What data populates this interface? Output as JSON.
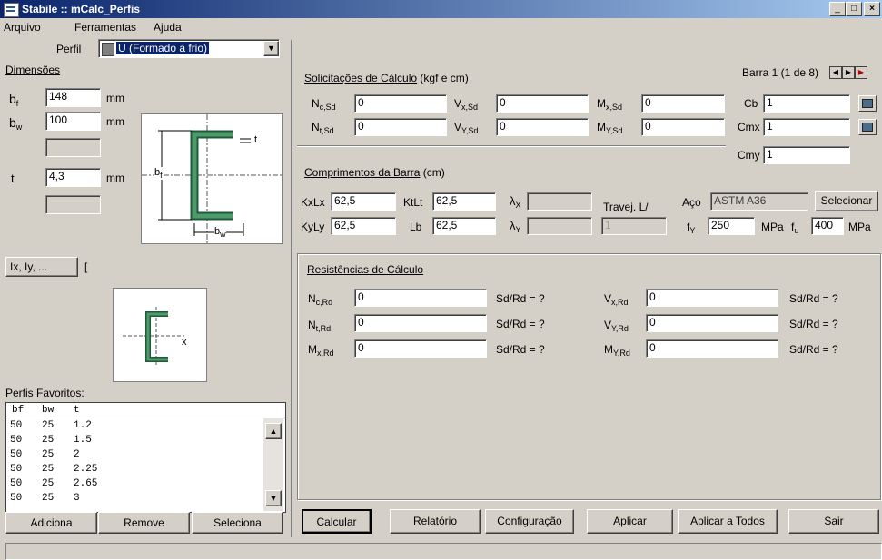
{
  "window": {
    "title": "Stabile :: mCalc_Perfis",
    "minimize": "_",
    "maximize": "□",
    "close": "×"
  },
  "menu": [
    "Arquivo",
    "Ferramentas",
    "Ajuda"
  ],
  "perfil": {
    "label": "Perfil",
    "value": "U (Formado a frio)"
  },
  "dimensoes": {
    "title": "Dimensões",
    "bf_label": "b",
    "bf_sub": "f",
    "bf": "148",
    "bw_label": "b",
    "bw_sub": "w",
    "bw": "100",
    "t_label": "t",
    "t": "4,3",
    "unit": "mm"
  },
  "diagram": {
    "bf": "b",
    "bf_sub": "f",
    "bw": "b",
    "bw_sub": "w",
    "t": "t",
    "x": "x"
  },
  "ixiy": {
    "button": "Ix, Iy, ...",
    "value": "["
  },
  "favoritos": {
    "title": "Perfis Favoritos:",
    "headers": [
      "bf",
      "bw",
      "t"
    ],
    "rows": [
      [
        "50",
        "25",
        "1.2"
      ],
      [
        "50",
        "25",
        "1.5"
      ],
      [
        "50",
        "25",
        "2"
      ],
      [
        "50",
        "25",
        "2.25"
      ],
      [
        "50",
        "25",
        "2.65"
      ],
      [
        "50",
        "25",
        "3"
      ]
    ],
    "buttons": [
      "Adiciona",
      "Remove",
      "Seleciona"
    ]
  },
  "solicitacoes": {
    "title": "Solicitações de Cálculo",
    "units": " (kgf e cm)",
    "barra": "Barra 1 (1 de 8)",
    "fields": [
      {
        "sym": "N",
        "sub": "c,Sd",
        "value": "0"
      },
      {
        "sym": "V",
        "sub": "x,Sd",
        "value": "0"
      },
      {
        "sym": "M",
        "sub": "x,Sd",
        "value": "0"
      },
      {
        "sym": "N",
        "sub": "t,Sd",
        "value": "0"
      },
      {
        "sym": "V",
        "sub": "Y,Sd",
        "value": "0"
      },
      {
        "sym": "M",
        "sub": "Y,Sd",
        "value": "0"
      }
    ],
    "cb": {
      "label": "Cb",
      "value": "1"
    },
    "cmx": {
      "label": "Cmx",
      "value": "1"
    },
    "cmy": {
      "label": "Cmy",
      "value": "1"
    }
  },
  "comprimentos": {
    "title": "Comprimentos da Barra",
    "units": " (cm)",
    "kxlx": {
      "label": "KxLx",
      "value": "62,5"
    },
    "ktlt": {
      "label": "KtLt",
      "value": "62,5"
    },
    "kyly": {
      "label": "KyLy",
      "value": "62,5"
    },
    "lb": {
      "label": "Lb",
      "value": "62,5"
    },
    "lambda_x": {
      "sym": "λ",
      "sub": "X",
      "value": ""
    },
    "lambda_y": {
      "sym": "λ",
      "sub": "Y",
      "value": ""
    },
    "travej": {
      "label": "Travej. L/",
      "value": "1"
    },
    "aco": {
      "label": "Aço",
      "value": "ASTM A36",
      "button": "Selecionar"
    },
    "fy": {
      "sym": "f",
      "sub": "Y",
      "value": "250",
      "unit": "MPa"
    },
    "fu": {
      "sym": "f",
      "sub": "u",
      "value": "400",
      "unit": "MPa"
    }
  },
  "resistencias": {
    "title": "Resistências de Cálculo",
    "rows": [
      {
        "sym": "N",
        "sub": "c,Rd",
        "value": "0",
        "ratio": "Sd/Rd = ?"
      },
      {
        "sym": "V",
        "sub": "x,Rd",
        "value": "0",
        "ratio": "Sd/Rd = ?"
      },
      {
        "sym": "N",
        "sub": "t,Rd",
        "value": "0",
        "ratio": "Sd/Rd = ?"
      },
      {
        "sym": "V",
        "sub": "Y,Rd",
        "value": "0",
        "ratio": "Sd/Rd = ?"
      },
      {
        "sym": "M",
        "sub": "x,Rd",
        "value": "0",
        "ratio": "Sd/Rd = ?"
      },
      {
        "sym": "M",
        "sub": "Y,Rd",
        "value": "0",
        "ratio": "Sd/Rd = ?"
      }
    ]
  },
  "actions": [
    "Calcular",
    "Relatório",
    "Configuração",
    "Aplicar",
    "Aplicar a Todos",
    "Sair"
  ]
}
